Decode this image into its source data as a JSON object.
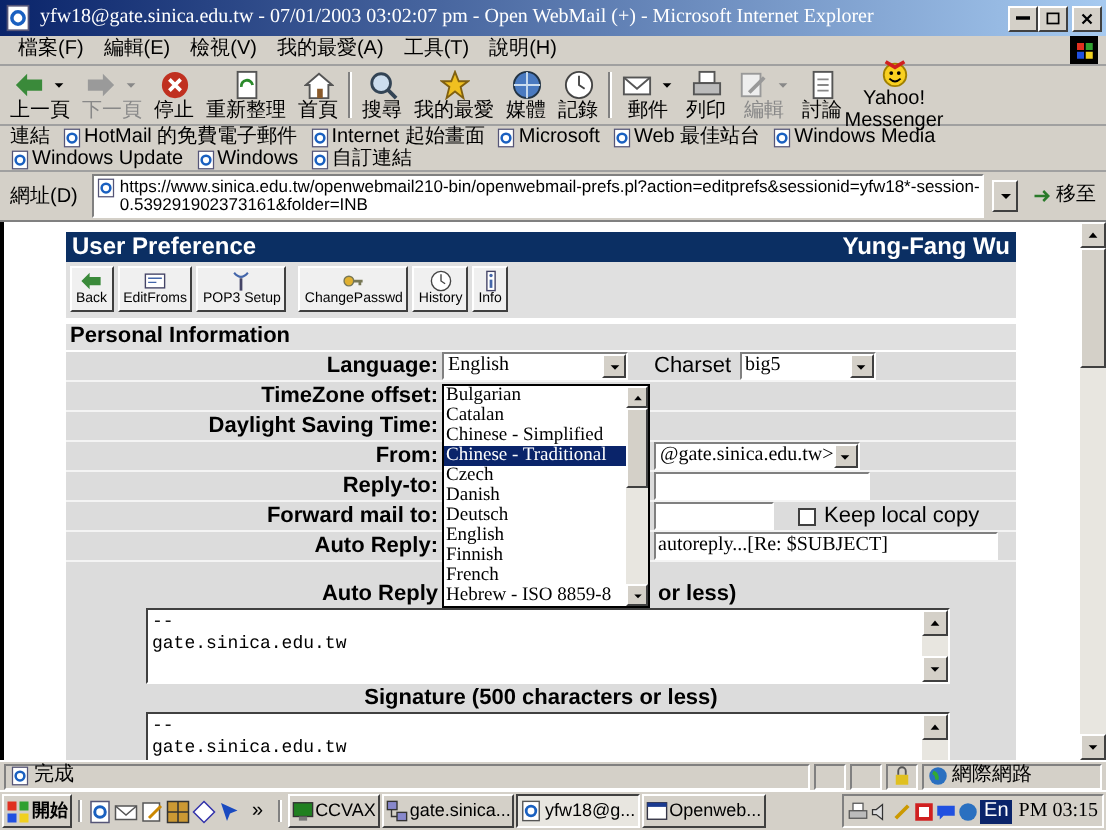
{
  "window": {
    "title": "yfw18@gate.sinica.edu.tw - 07/01/2003 03:02:07 pm - Open WebMail (+) - Microsoft Internet Explorer"
  },
  "menu": [
    "檔案(F)",
    "編輯(E)",
    "檢視(V)",
    "我的最愛(A)",
    "工具(T)",
    "說明(H)"
  ],
  "toolbar": [
    {
      "label": "上一頁",
      "kind": "back",
      "dropdown": true,
      "disabled": false,
      "separator_after": false
    },
    {
      "label": "下一頁",
      "kind": "forward",
      "dropdown": true,
      "disabled": true,
      "separator_after": false
    },
    {
      "label": "停止",
      "kind": "stop",
      "dropdown": false,
      "disabled": false,
      "separator_after": false
    },
    {
      "label": "重新整理",
      "kind": "refresh",
      "dropdown": false,
      "disabled": false,
      "separator_after": false
    },
    {
      "label": "首頁",
      "kind": "home",
      "dropdown": false,
      "disabled": false,
      "separator_after": true
    },
    {
      "label": "搜尋",
      "kind": "search",
      "dropdown": false,
      "disabled": false,
      "separator_after": false
    },
    {
      "label": "我的最愛",
      "kind": "favorites",
      "dropdown": false,
      "disabled": false,
      "separator_after": false
    },
    {
      "label": "媒體",
      "kind": "media",
      "dropdown": false,
      "disabled": false,
      "separator_after": false
    },
    {
      "label": "記錄",
      "kind": "history",
      "dropdown": false,
      "disabled": false,
      "separator_after": true
    },
    {
      "label": "郵件",
      "kind": "mail",
      "dropdown": true,
      "disabled": false,
      "separator_after": false
    },
    {
      "label": "列印",
      "kind": "print",
      "dropdown": false,
      "disabled": false,
      "separator_after": false
    },
    {
      "label": "編輯",
      "kind": "edit",
      "dropdown": true,
      "disabled": true,
      "separator_after": false
    },
    {
      "label": "討論",
      "kind": "discuss",
      "dropdown": false,
      "disabled": false,
      "separator_after": false
    },
    {
      "label": "Yahoo! Messenger",
      "kind": "messenger",
      "dropdown": false,
      "disabled": false,
      "separator_after": false
    }
  ],
  "links_bar": {
    "label": "連結",
    "items": [
      "HotMail 的免費電子郵件",
      "Internet 起始畫面",
      "Microsoft",
      "Web 最佳站台",
      "Windows Media",
      "Windows Update",
      "Windows",
      "自訂連結"
    ]
  },
  "address_bar": {
    "label": "網址(D)",
    "url": "https://www.sinica.edu.tw/openwebmail210-bin/openwebmail-prefs.pl?action=editprefs&sessionid=yfw18*-session-0.539291902373161&folder=INB",
    "go": "移至"
  },
  "page": {
    "title": "User Preference",
    "user": "Yung-Fang Wu",
    "buttons": [
      {
        "label": "Back",
        "kind": "back"
      },
      {
        "label": "EditFroms",
        "kind": "froms"
      },
      {
        "label": "POP3 Setup",
        "kind": "pop3"
      },
      {
        "label": "ChangePasswd",
        "kind": "password"
      },
      {
        "label": "History",
        "kind": "history"
      },
      {
        "label": "Info",
        "kind": "info"
      }
    ],
    "section": "Personal Information",
    "fields": [
      {
        "label": "Language:",
        "kind": "select",
        "value": "English",
        "extra": {
          "label": "Charset",
          "value": "big5"
        }
      },
      {
        "label": "TimeZone offset:",
        "kind": "covered"
      },
      {
        "label": "Daylight Saving Time:",
        "kind": "covered"
      },
      {
        "label": "From:",
        "kind": "select",
        "value": "@gate.sinica.edu.tw>"
      },
      {
        "label": "Reply-to:",
        "kind": "text"
      },
      {
        "label": "Forward mail to:",
        "kind": "text",
        "checkbox": {
          "label": "Keep local copy",
          "checked": false
        }
      },
      {
        "label": "Auto Reply:",
        "kind": "text",
        "value": "autoreply...[Re: $SUBJECT]"
      }
    ],
    "autoreply_text": {
      "label_start": "Auto Reply",
      "label_end": "or less)",
      "value": "--\ngate.sinica.edu.tw"
    },
    "signature": {
      "label": "Signature (500 characters or less)",
      "value": "--\ngate.sinica.edu.tw"
    },
    "language_list": [
      {
        "label": "Bulgarian",
        "selected": false
      },
      {
        "label": "Catalan",
        "selected": false
      },
      {
        "label": "Chinese - Simplified",
        "selected": false
      },
      {
        "label": "Chinese - Traditional",
        "selected": true
      },
      {
        "label": "Czech",
        "selected": false
      },
      {
        "label": "Danish",
        "selected": false
      },
      {
        "label": "Deutsch",
        "selected": false
      },
      {
        "label": "English",
        "selected": false
      },
      {
        "label": "Finnish",
        "selected": false
      },
      {
        "label": "French",
        "selected": false
      },
      {
        "label": "Hebrew - ISO 8859-8",
        "selected": false
      }
    ]
  },
  "status_bar": {
    "text": "完成",
    "zone": "網際網路"
  },
  "taskbar": {
    "start": "開始",
    "more": "»",
    "tasks": [
      {
        "label": "CCVAX",
        "kind": "terminal",
        "selected": false
      },
      {
        "label": "gate.sinica...",
        "kind": "telnet",
        "selected": false
      },
      {
        "label": "yfw18@g...",
        "kind": "browser",
        "selected": true
      },
      {
        "label": "Openweb...",
        "kind": "app",
        "selected": false
      }
    ],
    "language": "En",
    "clock": "PM 03:15"
  }
}
